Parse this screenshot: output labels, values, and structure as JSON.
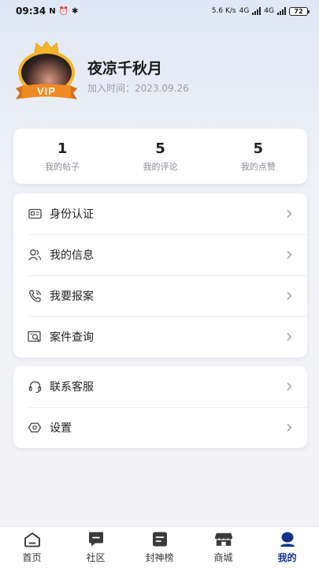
{
  "status_bar": {
    "time": "09:34",
    "left_icons": [
      "N",
      "alarm-icon",
      "bluetooth-icon"
    ],
    "network_speed": "5.6 K/s",
    "signal_1_type": "4G",
    "signal_2_type": "4G",
    "battery": "72"
  },
  "profile": {
    "vip_label": "VIP",
    "username": "夜凉千秋月",
    "join_date": "加入时间：2023.09.26"
  },
  "stats": [
    {
      "value": "1",
      "label": "我的帖子"
    },
    {
      "value": "5",
      "label": "我的评论"
    },
    {
      "value": "5",
      "label": "我的点赞"
    }
  ],
  "menu_group_1": [
    {
      "label": "身份认证",
      "icon": "id-card-icon"
    },
    {
      "label": "我的信息",
      "icon": "users-icon"
    },
    {
      "label": "我要报案",
      "icon": "phone-call-icon"
    },
    {
      "label": "案件查询",
      "icon": "search-document-icon"
    }
  ],
  "menu_group_2": [
    {
      "label": "联系客服",
      "icon": "headset-icon"
    },
    {
      "label": "设置",
      "icon": "settings-eye-icon"
    }
  ],
  "tabbar": [
    {
      "label": "首页",
      "icon": "home-icon",
      "active": false
    },
    {
      "label": "社区",
      "icon": "chat-icon",
      "active": false
    },
    {
      "label": "封神榜",
      "icon": "list-icon",
      "active": false
    },
    {
      "label": "商城",
      "icon": "store-icon",
      "active": false
    },
    {
      "label": "我的",
      "icon": "user-icon",
      "active": true
    }
  ],
  "colors": {
    "accent": "#15328a",
    "icon_dark": "#444444",
    "vip_gold": "#f5b52a",
    "vip_orange": "#f08a24"
  }
}
